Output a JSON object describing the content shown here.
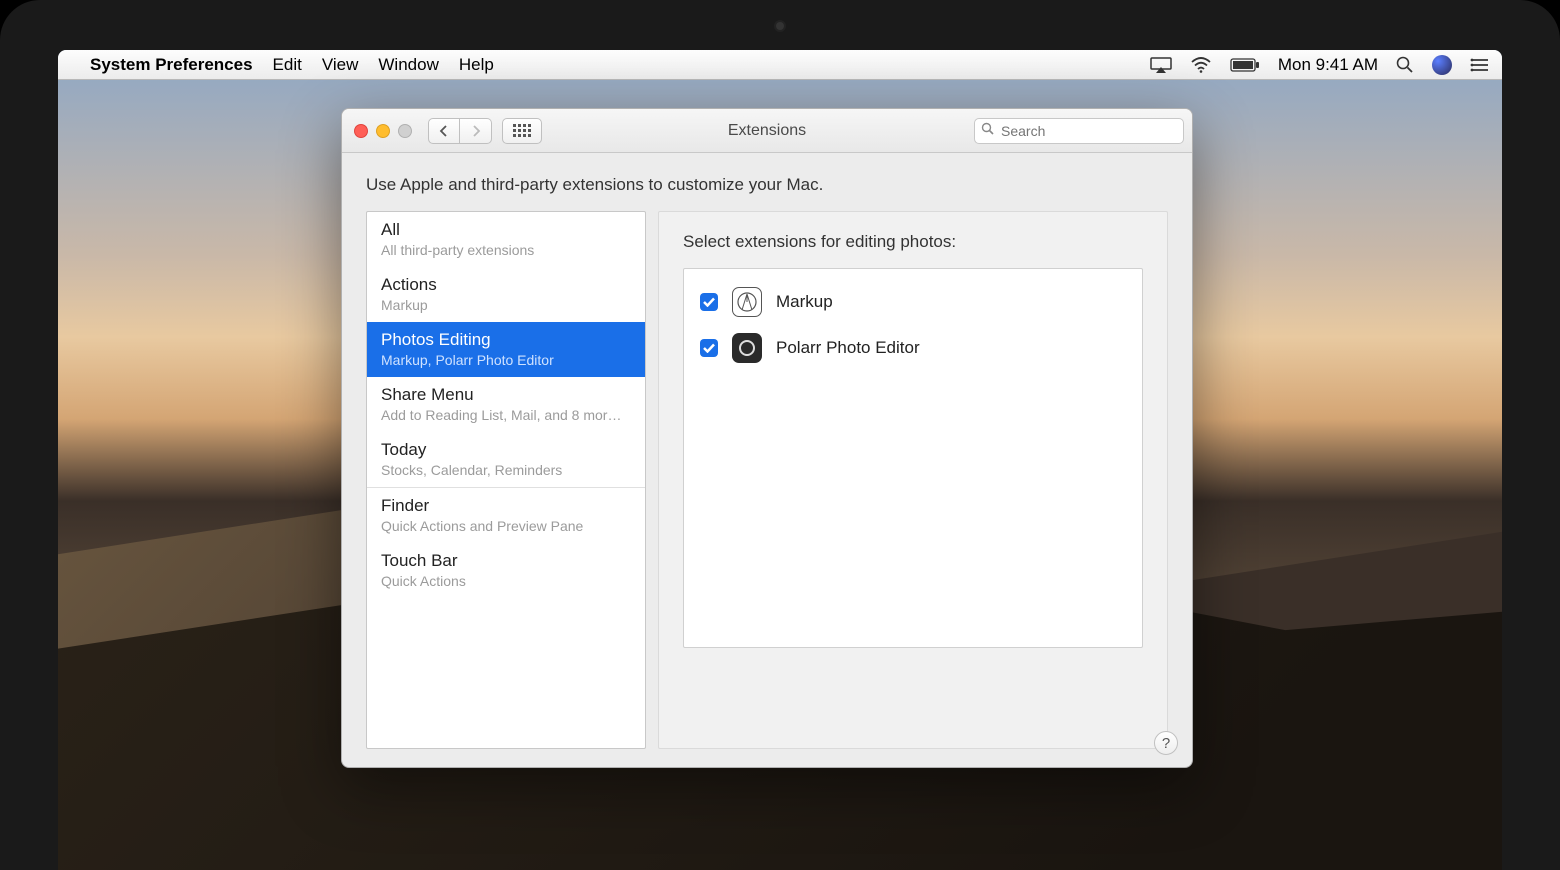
{
  "menubar": {
    "app_name": "System Preferences",
    "menus": [
      "Edit",
      "View",
      "Window",
      "Help"
    ],
    "clock": "Mon 9:41 AM"
  },
  "window": {
    "title": "Extensions",
    "search_placeholder": "Search",
    "description": "Use Apple and third-party extensions to customize your Mac.",
    "help": "?"
  },
  "sidebar": {
    "groups": [
      [
        {
          "title": "All",
          "sub": "All third-party extensions",
          "selected": false
        },
        {
          "title": "Actions",
          "sub": "Markup",
          "selected": false
        },
        {
          "title": "Photos Editing",
          "sub": "Markup, Polarr Photo Editor",
          "selected": true
        },
        {
          "title": "Share Menu",
          "sub": "Add to Reading List, Mail, and 8 mor…",
          "selected": false
        },
        {
          "title": "Today",
          "sub": "Stocks, Calendar, Reminders",
          "selected": false
        }
      ],
      [
        {
          "title": "Finder",
          "sub": "Quick Actions and Preview Pane",
          "selected": false
        },
        {
          "title": "Touch Bar",
          "sub": "Quick Actions",
          "selected": false
        }
      ]
    ]
  },
  "detail": {
    "heading": "Select extensions for editing photos:",
    "extensions": [
      {
        "name": "Markup",
        "checked": true,
        "icon": "markup"
      },
      {
        "name": "Polarr Photo Editor",
        "checked": true,
        "icon": "polarr"
      }
    ]
  }
}
